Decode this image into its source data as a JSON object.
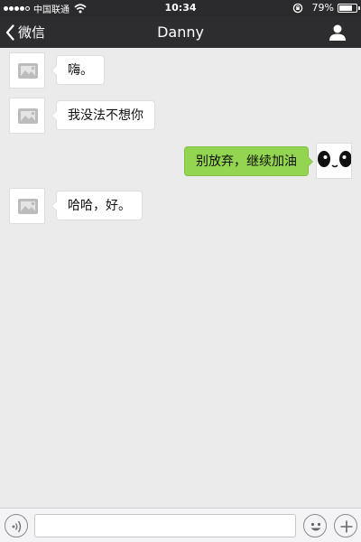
{
  "status_bar": {
    "carrier": "中国联通",
    "time": "10:34",
    "battery_text": "79%",
    "battery_level": 0.79,
    "signal_bars_filled": 4,
    "signal_bars_total": 5
  },
  "nav": {
    "back_label": "微信",
    "title": "Danny",
    "back_icon": "chevron-left-icon",
    "profile_icon": "person-icon"
  },
  "messages": [
    {
      "from": "contact",
      "text": "嗨。"
    },
    {
      "from": "contact",
      "text": "我没法不想你"
    },
    {
      "from": "me",
      "text": "别放弃，继续加油"
    },
    {
      "from": "contact",
      "text": "哈哈，好。"
    }
  ],
  "input_bar": {
    "value": "",
    "voice_icon": "voice-icon",
    "emoji_icon": "smiley-icon",
    "plus_icon": "plus-icon"
  },
  "colors": {
    "nav_bg": "#2d2d30",
    "chat_bg": "#ebebeb",
    "outgoing_bubble": "#93d550",
    "incoming_bubble": "#ffffff"
  }
}
